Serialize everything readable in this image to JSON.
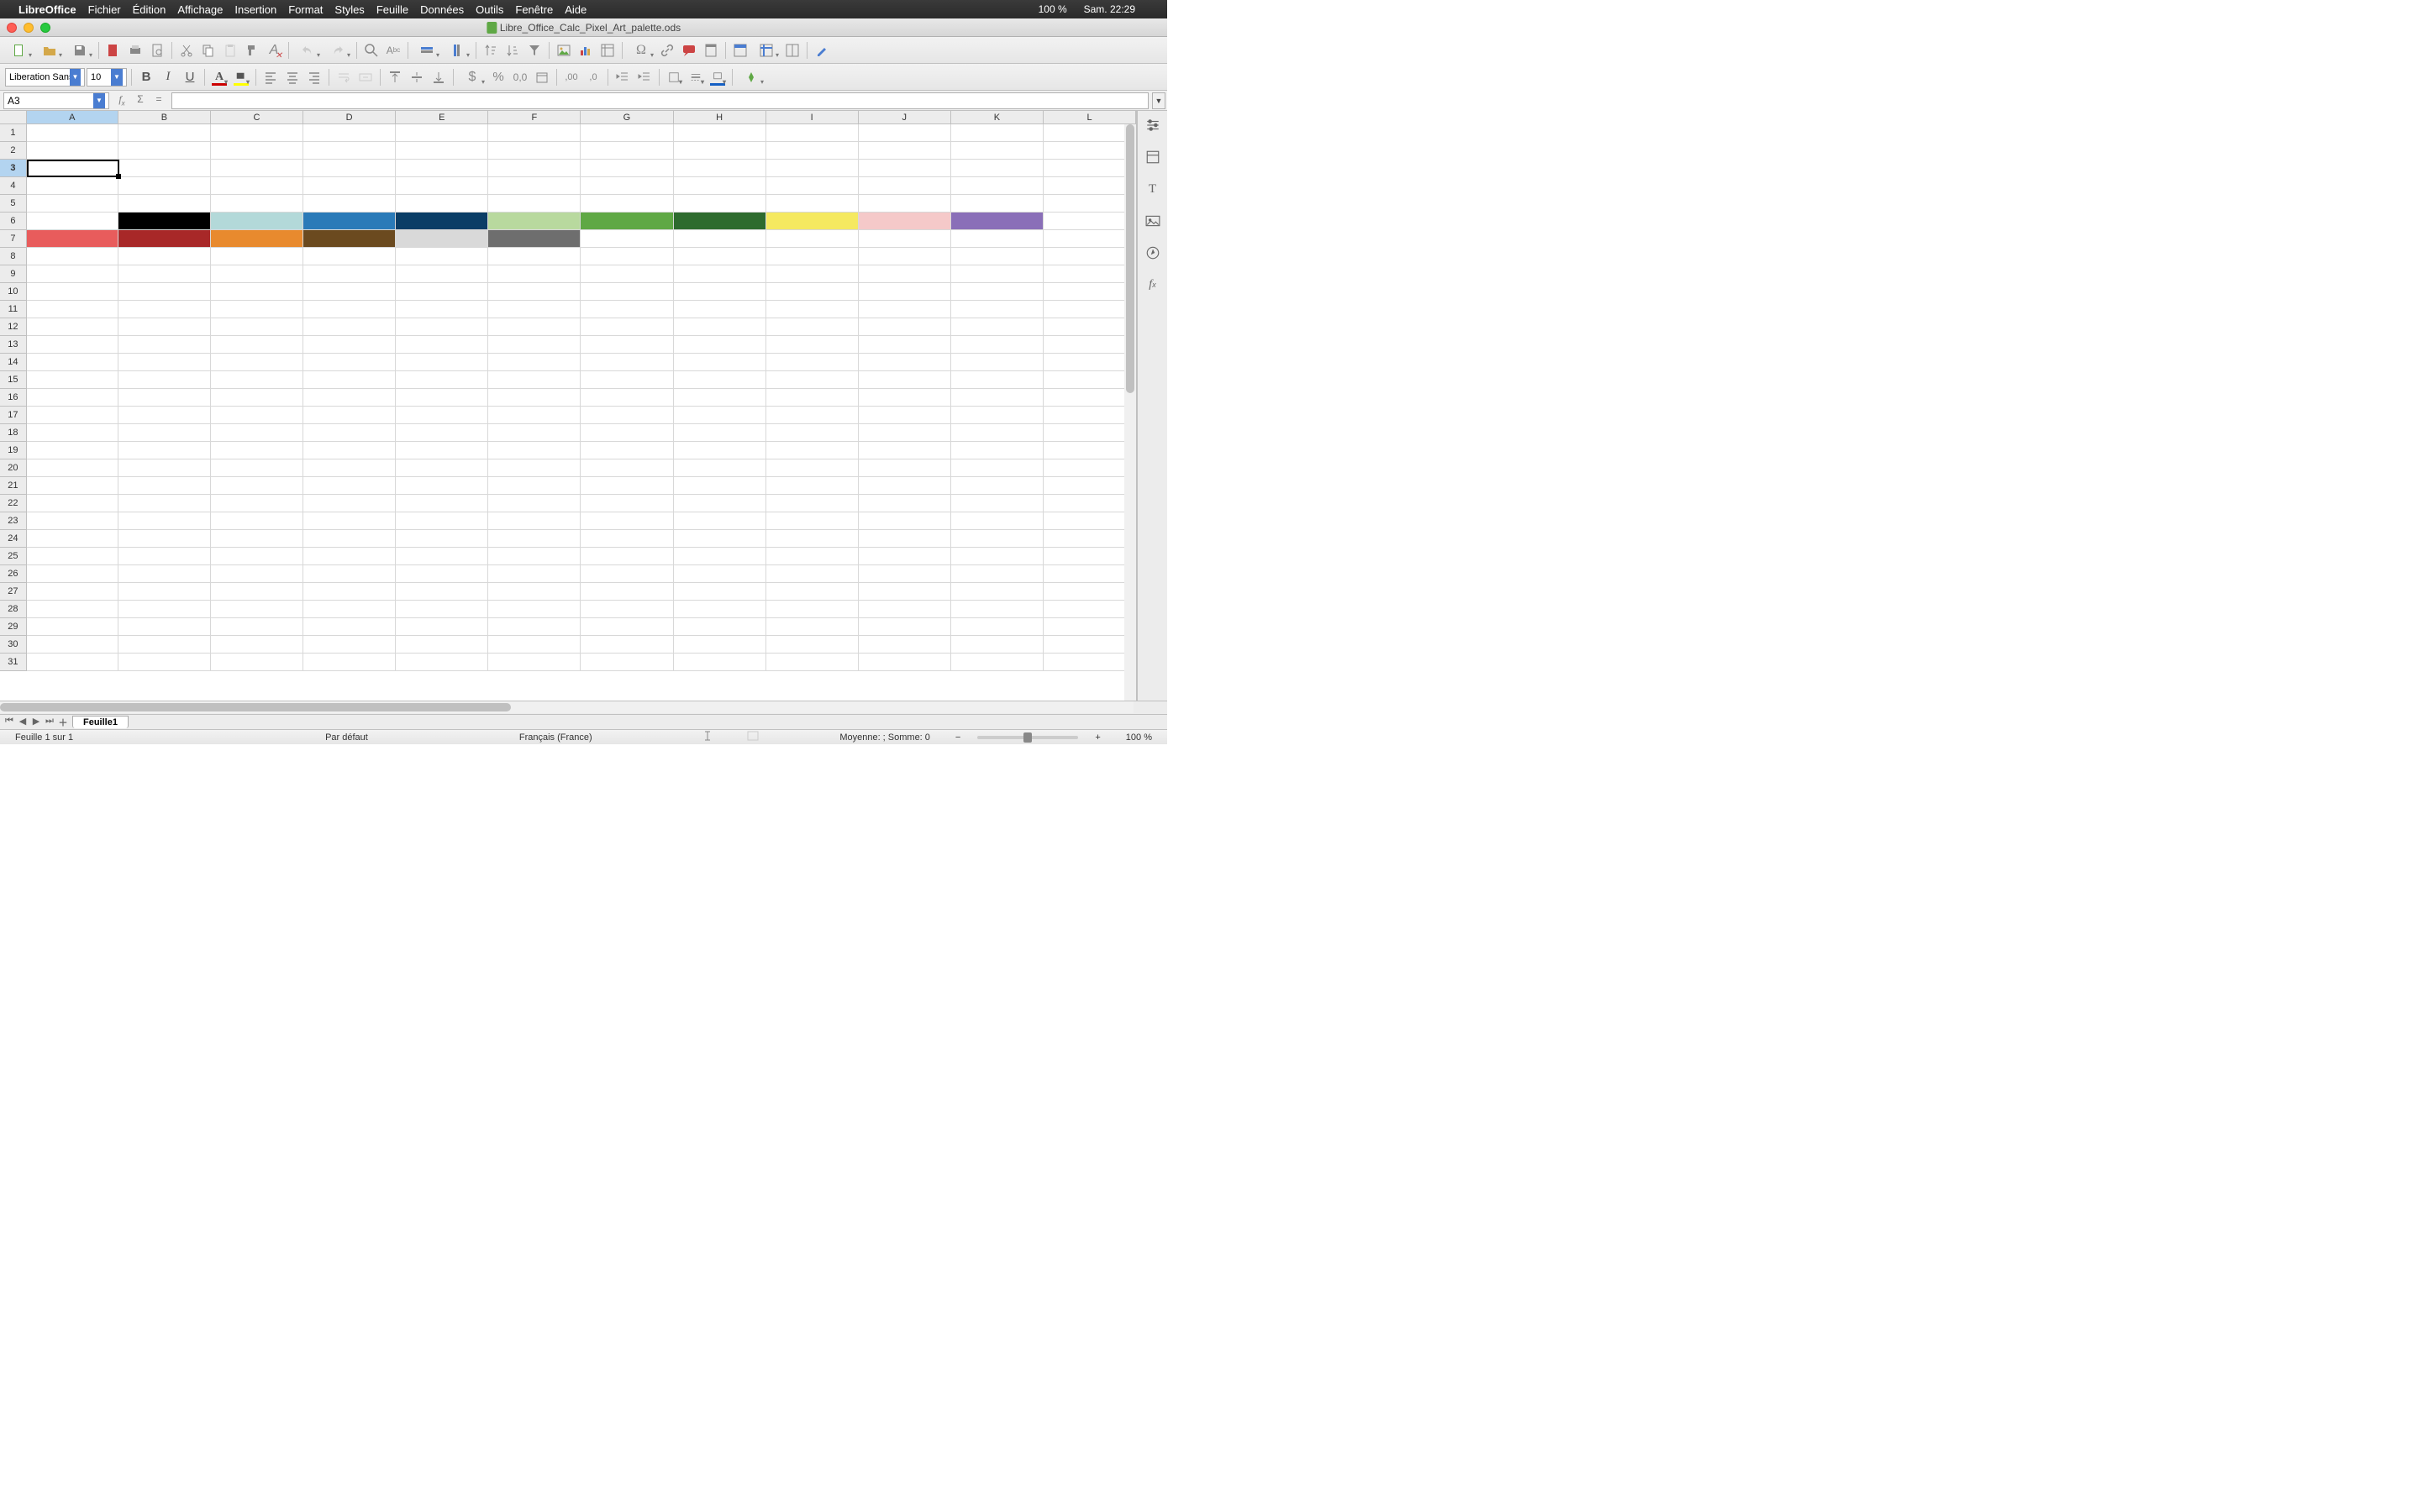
{
  "menubar": {
    "app": "LibreOffice",
    "items": [
      "Fichier",
      "Édition",
      "Affichage",
      "Insertion",
      "Format",
      "Styles",
      "Feuille",
      "Données",
      "Outils",
      "Fenêtre",
      "Aide"
    ],
    "battery": "100 %",
    "clock": "Sam. 22:29"
  },
  "titlebar": {
    "filename": "Libre_Office_Calc_Pixel_Art_palette.ods"
  },
  "format": {
    "font_name": "Liberation Sans",
    "font_size": "10"
  },
  "formulabar": {
    "cell_ref": "A3"
  },
  "columns": [
    "A",
    "B",
    "C",
    "D",
    "E",
    "F",
    "G",
    "H",
    "I",
    "J",
    "K",
    "L"
  ],
  "row_count": 31,
  "selected": {
    "col": 0,
    "row": 2
  },
  "palette": {
    "row6": {
      "B": "#000000",
      "C": "#b3d9d9",
      "D": "#2a7ab8",
      "E": "#0a3d66",
      "F": "#b8d99e",
      "G": "#5fa845",
      "H": "#2e6b2e",
      "I": "#f5e960",
      "J": "#f5c9c9",
      "K": "#8a6fb8"
    },
    "row7": {
      "A": "#e85c5c",
      "B": "#a82828",
      "C": "#e88a2e",
      "D": "#6b4a1f",
      "E": "#d9d9d9",
      "F": "#6e6e6e"
    }
  },
  "sheettabs": {
    "active": "Feuille1"
  },
  "statusbar": {
    "sheet_info": "Feuille 1 sur 1",
    "style": "Par défaut",
    "lang": "Français (France)",
    "summary": "Moyenne: ; Somme: 0",
    "zoom": "100 %"
  }
}
